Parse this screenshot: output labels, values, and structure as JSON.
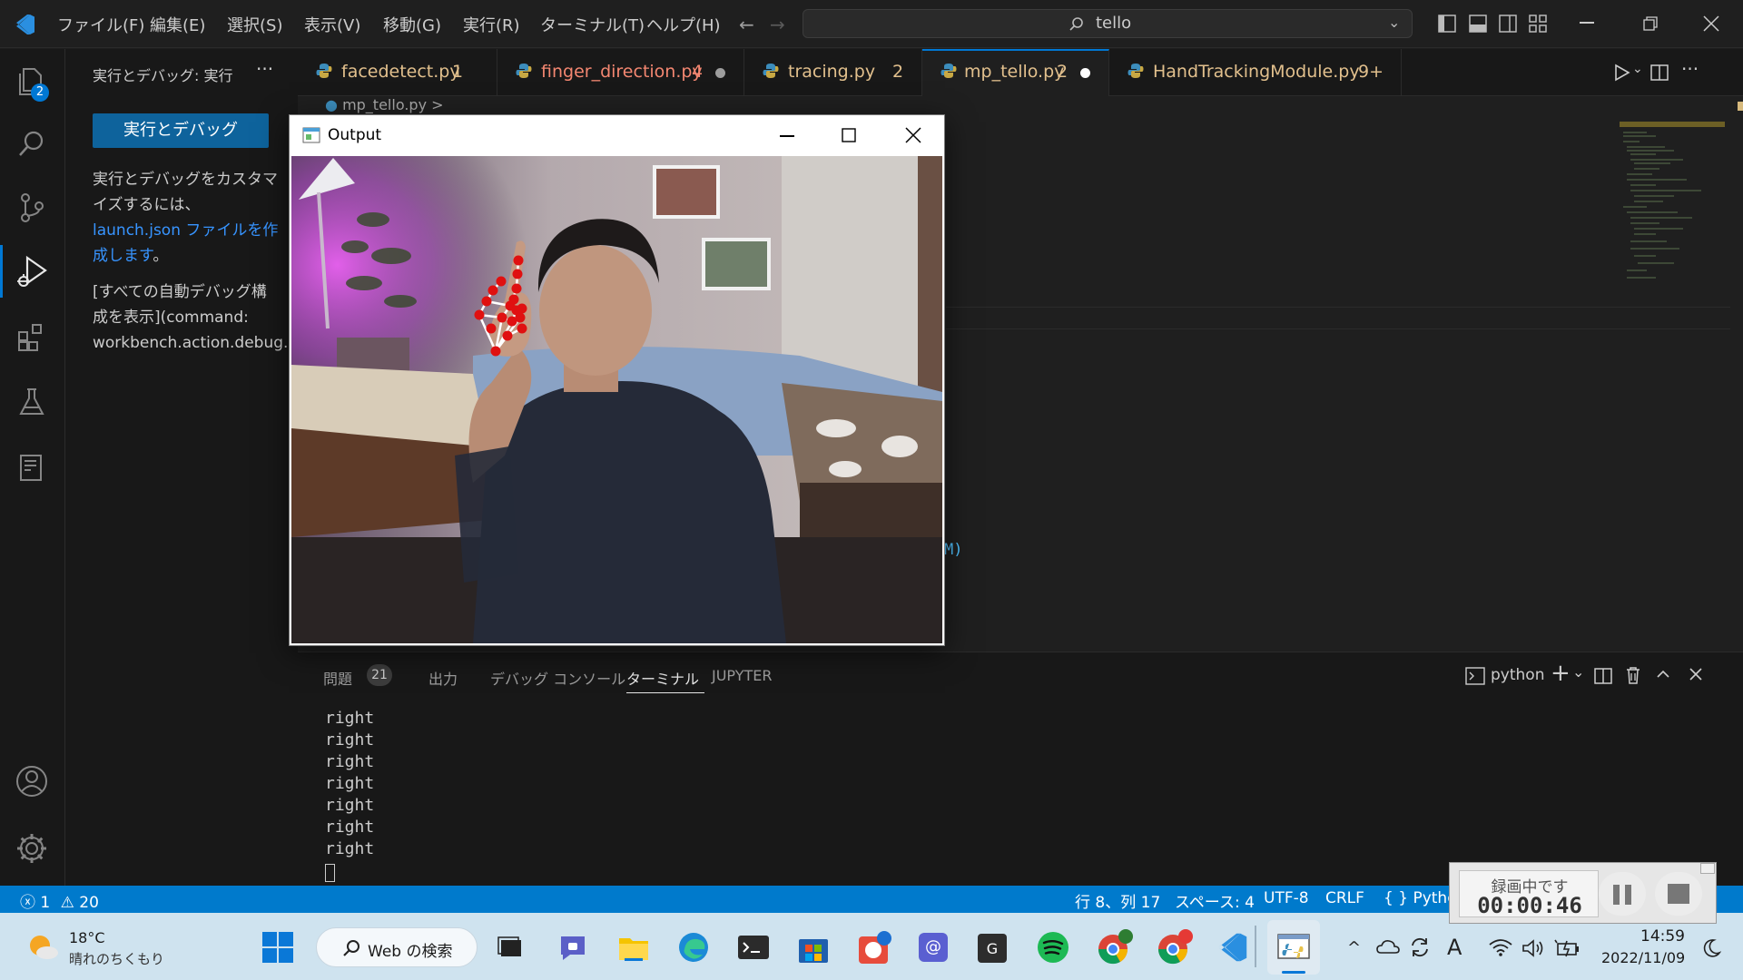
{
  "titlebar": {
    "menus": [
      "ファイル(F)",
      "編集(E)",
      "選択(S)",
      "表示(V)",
      "移動(G)",
      "実行(R)",
      "ターミナル(T)",
      "ヘルプ(H)"
    ],
    "search_text": "tello"
  },
  "activitybar": {
    "explorer_badge": "2"
  },
  "sidebar": {
    "title": "実行とデバッグ: 実行",
    "run_button": "実行とデバッグ",
    "text1": "実行とデバッグをカスタマ",
    "text2": "イズするには、",
    "link1": "launch.json ファイルを作",
    "link2": "成します",
    "link_suffix": "。",
    "text3": "[すべての自動デバッグ構",
    "text4": "成を表示](command:",
    "text5": "workbench.action.debug."
  },
  "tabs": [
    {
      "name": "facedetect.py",
      "badge": "1",
      "color": "#e2c08d"
    },
    {
      "name": "finger_direction.py",
      "badge": "4",
      "color": "#f48771"
    },
    {
      "name": "tracing.py",
      "badge": "2",
      "color": "#e2c08d"
    },
    {
      "name": "mp_tello.py",
      "badge": "2",
      "color": "#e2c08d"
    },
    {
      "name": "HandTrackingModule.py",
      "badge": "9+",
      "color": "#e2c08d"
    }
  ],
  "editor": {
    "breadcrumb": "mp_tello.py >",
    "code_fragment": "M)"
  },
  "output_window": {
    "title": "Output"
  },
  "panel": {
    "tabs": [
      "問題",
      "出力",
      "デバッグ コンソール",
      "ターミナル",
      "JUPYTER"
    ],
    "problems_count": "21",
    "terminal_name": "python",
    "terminal_lines": [
      "right",
      "right",
      "right",
      "right",
      "right",
      "right",
      "right"
    ]
  },
  "statusbar": {
    "errors": "1",
    "warnings": "20",
    "position": "行 8、列 17",
    "spaces": "スペース: 4",
    "encoding": "UTF-8",
    "eol": "CRLF",
    "language": "Pytho"
  },
  "recorder": {
    "label": "録画中です",
    "time": "00:00:46"
  },
  "taskbar": {
    "weather_temp": "18°C",
    "weather_desc": "晴れのちくもり",
    "search_label": "Web の検索",
    "time": "14:59",
    "date": "2022/11/09"
  },
  "colors": {
    "accent": "#007acc",
    "run_button": "#0e639c",
    "link": "#3794ff"
  }
}
